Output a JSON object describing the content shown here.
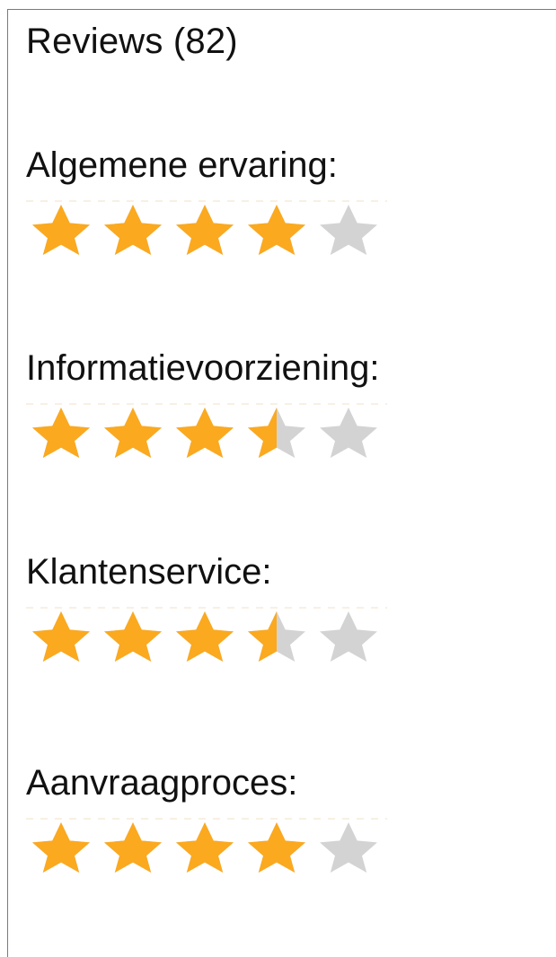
{
  "reviews": {
    "title": "Reviews (82)"
  },
  "ratings": [
    {
      "label": "Algemene ervaring:",
      "value": 4,
      "max": 5
    },
    {
      "label": "Informatievoorziening:",
      "value": 3.5,
      "max": 5
    },
    {
      "label": "Klantenservice:",
      "value": 3.5,
      "max": 5
    },
    {
      "label": "Aanvraagproces:",
      "value": 4,
      "max": 5
    }
  ],
  "colors": {
    "star_filled": "#fba91f",
    "star_empty": "#d3d3d3",
    "border": "#7a7a7a",
    "text": "#111111"
  }
}
